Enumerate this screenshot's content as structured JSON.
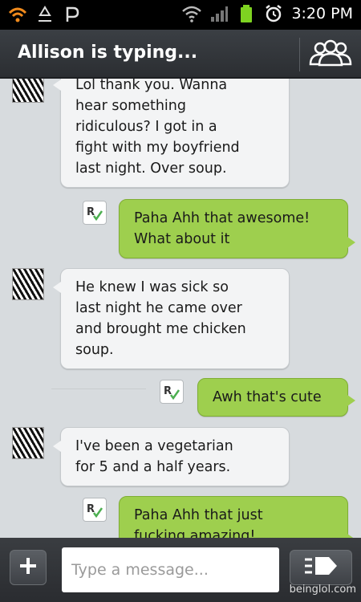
{
  "status_bar": {
    "time": "3:20 PM",
    "icons": [
      "wifi-notification-icon",
      "recycle-icon",
      "parking-icon",
      "wifi-signal-icon",
      "cell-signal-icon",
      "battery-icon",
      "alarm-icon"
    ]
  },
  "header": {
    "title": "Allison is typing...",
    "contacts_icon": "contacts-icon"
  },
  "messages": [
    {
      "direction": "in",
      "text": "Lol thank you. Wanna\nhear something\nridiculous? I got in a\nfight with my boyfriend\nlast night. Over soup."
    },
    {
      "direction": "out",
      "text": "Paha Ahh that awesome!\nWhat about it"
    },
    {
      "direction": "in",
      "text": "He knew I was sick so\nlast night he came over\nand brought me chicken\nsoup."
    },
    {
      "direction": "out",
      "text": "Awh that's cute"
    },
    {
      "direction": "in",
      "text": "I've been a vegetarian\nfor 5 and a half years."
    },
    {
      "direction": "out",
      "text": "Paha Ahh that just\nfucking amazing!"
    }
  ],
  "composer": {
    "placeholder": "Type a message...",
    "add_icon": "plus-icon",
    "send_icon": "send-icon"
  },
  "watermark": "beinglol.com",
  "colors": {
    "outgoing_bubble": "#9ecf4e",
    "incoming_bubble": "#f3f4f5",
    "background": "#d7dbde",
    "header": "#2b2e32"
  }
}
